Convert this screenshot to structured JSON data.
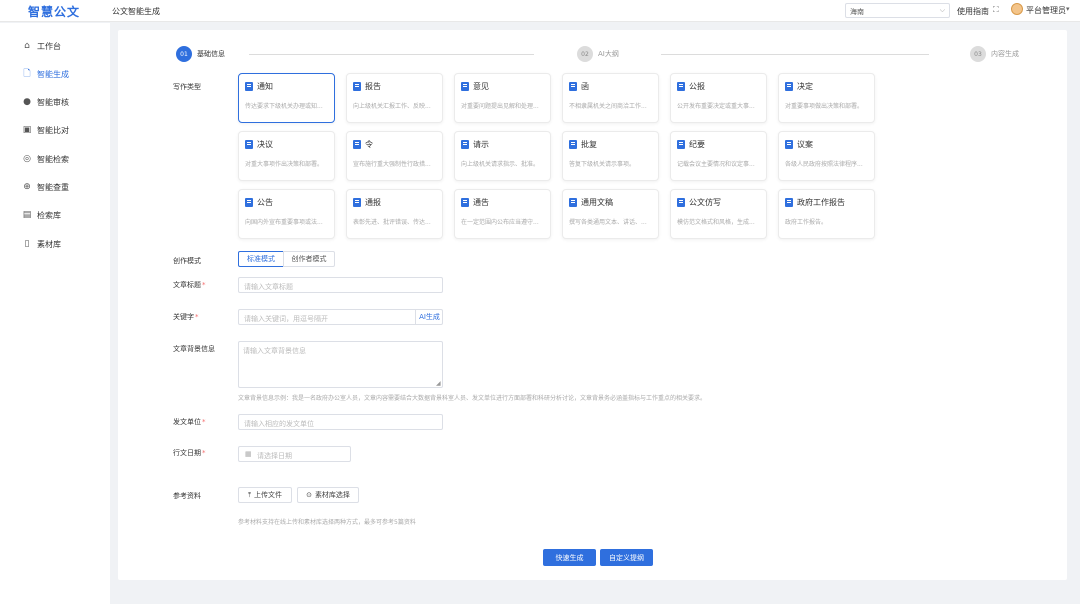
{
  "app": {
    "logo": "智慧公文",
    "page_title": "公文智能生成"
  },
  "header": {
    "region": "海南",
    "guide": "使用指南",
    "user": "平台管理员"
  },
  "sidebar": {
    "items": [
      {
        "label": "工作台",
        "icon": "home-icon"
      },
      {
        "label": "智能生成",
        "icon": "document-icon",
        "active": true
      },
      {
        "label": "智能审核",
        "icon": "user-icon"
      },
      {
        "label": "智能比对",
        "icon": "compare-icon"
      },
      {
        "label": "智能检索",
        "icon": "location-icon"
      },
      {
        "label": "智能查重",
        "icon": "plus-circle-icon"
      },
      {
        "label": "检索库",
        "icon": "library-icon"
      },
      {
        "label": "素材库",
        "icon": "folder-icon"
      }
    ]
  },
  "steps": [
    {
      "num": "01",
      "label": "基础信息",
      "state": "active"
    },
    {
      "num": "02",
      "label": "AI大纲",
      "state": "pending"
    },
    {
      "num": "03",
      "label": "内容生成",
      "state": "pending"
    }
  ],
  "form": {
    "type_label": "写作类型",
    "doc_types": [
      {
        "title": "通知",
        "desc": "传达要求下级机关办理或知...",
        "selected": true
      },
      {
        "title": "报告",
        "desc": "向上级机关汇报工作、反映..."
      },
      {
        "title": "意见",
        "desc": "对重要问题提出见解和处理..."
      },
      {
        "title": "函",
        "desc": "不相隶属机关之间商洽工作..."
      },
      {
        "title": "公报",
        "desc": "公开发布重要决定或重大事..."
      },
      {
        "title": "决定",
        "desc": "对重要事项做出决策和部署。"
      },
      {
        "title": "决议",
        "desc": "对重大事项作出决策和部署。"
      },
      {
        "title": "令",
        "desc": "宣布施行重大强制性行政措..."
      },
      {
        "title": "请示",
        "desc": "向上级机关请求指示、批准。"
      },
      {
        "title": "批复",
        "desc": "答复下级机关请示事项。"
      },
      {
        "title": "纪要",
        "desc": "记载会议主要情况和议定事..."
      },
      {
        "title": "议案",
        "desc": "各级人民政府按照法律程序..."
      },
      {
        "title": "公告",
        "desc": "向国内外宣布重要事项或法..."
      },
      {
        "title": "通报",
        "desc": "表彰先进、批评错误、传达..."
      },
      {
        "title": "通告",
        "desc": "在一定范围内公布应当遵守..."
      },
      {
        "title": "通用文稿",
        "desc": "撰写各类通用文本、讲话、..."
      },
      {
        "title": "公文仿写",
        "desc": "模仿范文格式和风格，生成..."
      },
      {
        "title": "政府工作报告",
        "desc": "政府工作报告。"
      }
    ],
    "mode_label": "创作模式",
    "modes": [
      "标准模式",
      "创作者模式"
    ],
    "title_label": "文章标题",
    "title_placeholder": "请输入文章标题",
    "keywords_label": "关键字",
    "keywords_placeholder": "请输入关键词，用逗号隔开",
    "ai_generate": "AI生成",
    "background_label": "文章背景信息",
    "background_placeholder": "请输入文章背景信息",
    "background_hint": "文章背景信息示例：我是一名政府办公室人员，文章内容需要结合大数据背景科室人员、发文单位进行方面部署和科研分析讨论，文章背景务必涵盖指标与工作重点的相关要求。",
    "unit_label": "发文单位",
    "unit_placeholder": "请输入相应的发文单位",
    "date_label": "行文日期",
    "date_placeholder": "请选择日期",
    "ref_label": "参考资料",
    "upload_button": "上传文件",
    "library_button": "素材库选择",
    "ref_hint": "参考材料支持在线上传和素材库选择两种方式，最多可参考5篇资料",
    "quick_generate": "快速生成",
    "custom_outline": "自定义提纲"
  }
}
